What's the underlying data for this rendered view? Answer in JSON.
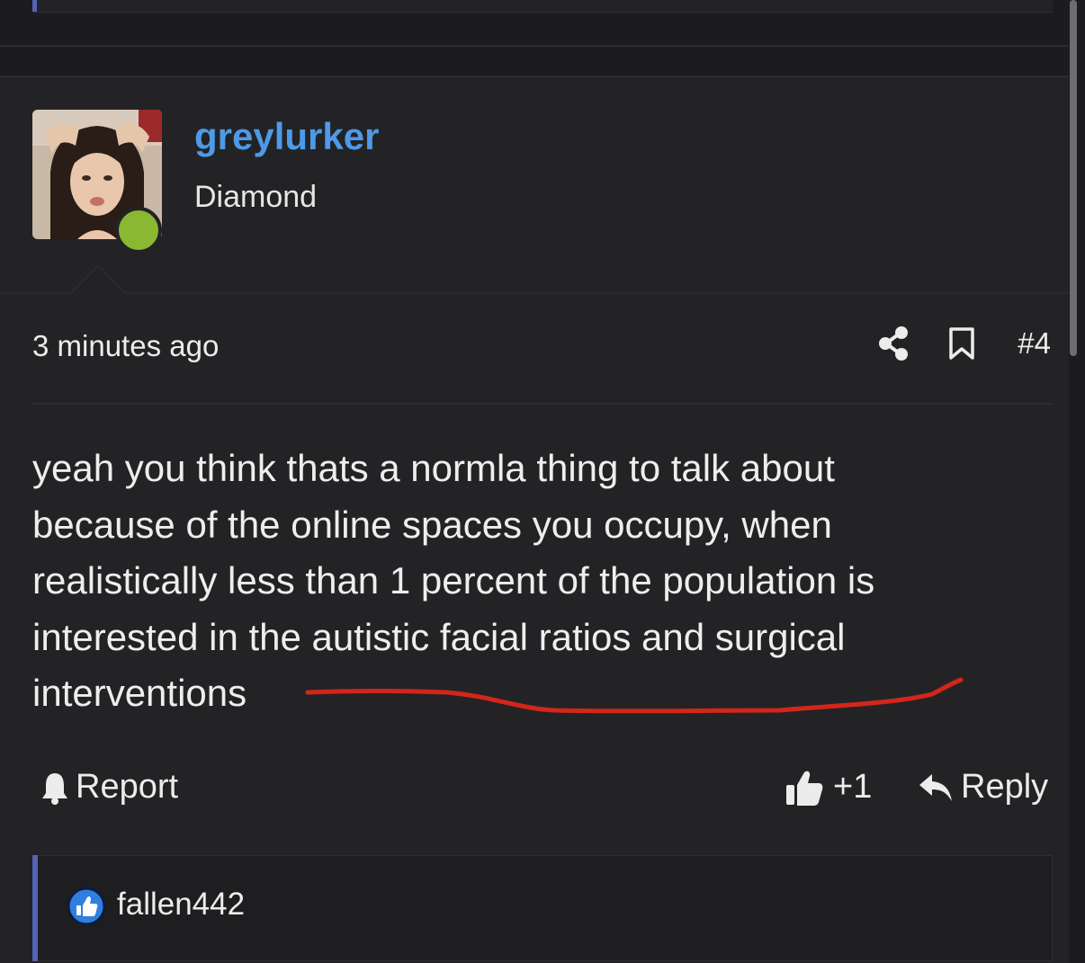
{
  "post": {
    "author": {
      "username": "greylurker",
      "rank": "Diamond",
      "online": true
    },
    "timestamp": "3 minutes ago",
    "post_number": "#4",
    "body": "yeah you think thats a normla thing to talk about because of the online spaces you occupy, when realistically less than 1 percent of the population is interested in the autistic facial ratios and surgical interventions",
    "actions": {
      "report_label": "Report",
      "like_count": "+1",
      "reply_label": "Reply"
    },
    "reactions": {
      "users": [
        "fallen442"
      ]
    }
  },
  "icons": {
    "share": "share-icon",
    "bookmark": "bookmark-icon",
    "report": "bell-icon",
    "like": "thumbs-up-icon",
    "reply": "reply-arrow-icon",
    "reaction": "like-reaction-icon"
  },
  "colors": {
    "background": "#1c1c1e",
    "card": "#232325",
    "username": "#4d9ae8",
    "online": "#8ab832",
    "accent": "#5662b8",
    "reaction_blue": "#2f7fe0",
    "scribble": "#d3261a"
  }
}
